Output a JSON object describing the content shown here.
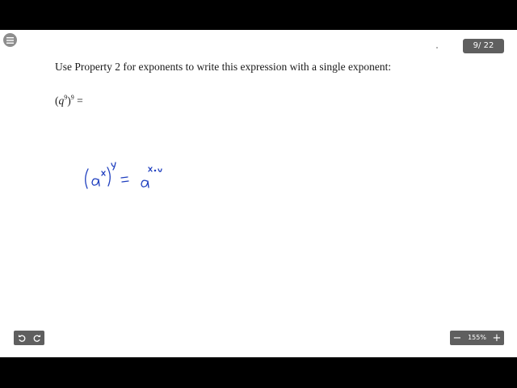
{
  "viewer": {
    "page_counter": "9/ 22",
    "zoom_level": "155%",
    "zoom_out_label": "−",
    "zoom_in_label": "+"
  },
  "content": {
    "prompt": "Use Property 2 for exponents to write this expression with a single exponent:",
    "expression": {
      "base": "q",
      "inner_exponent": "9",
      "outer_exponent": "9",
      "equals": "="
    }
  },
  "handwriting": {
    "color": "#1f3fbf",
    "icon": "handwritten-power-rule-note"
  },
  "icons": {
    "menu": "menu-icon",
    "undo": "undo-icon",
    "redo": "redo-icon"
  }
}
